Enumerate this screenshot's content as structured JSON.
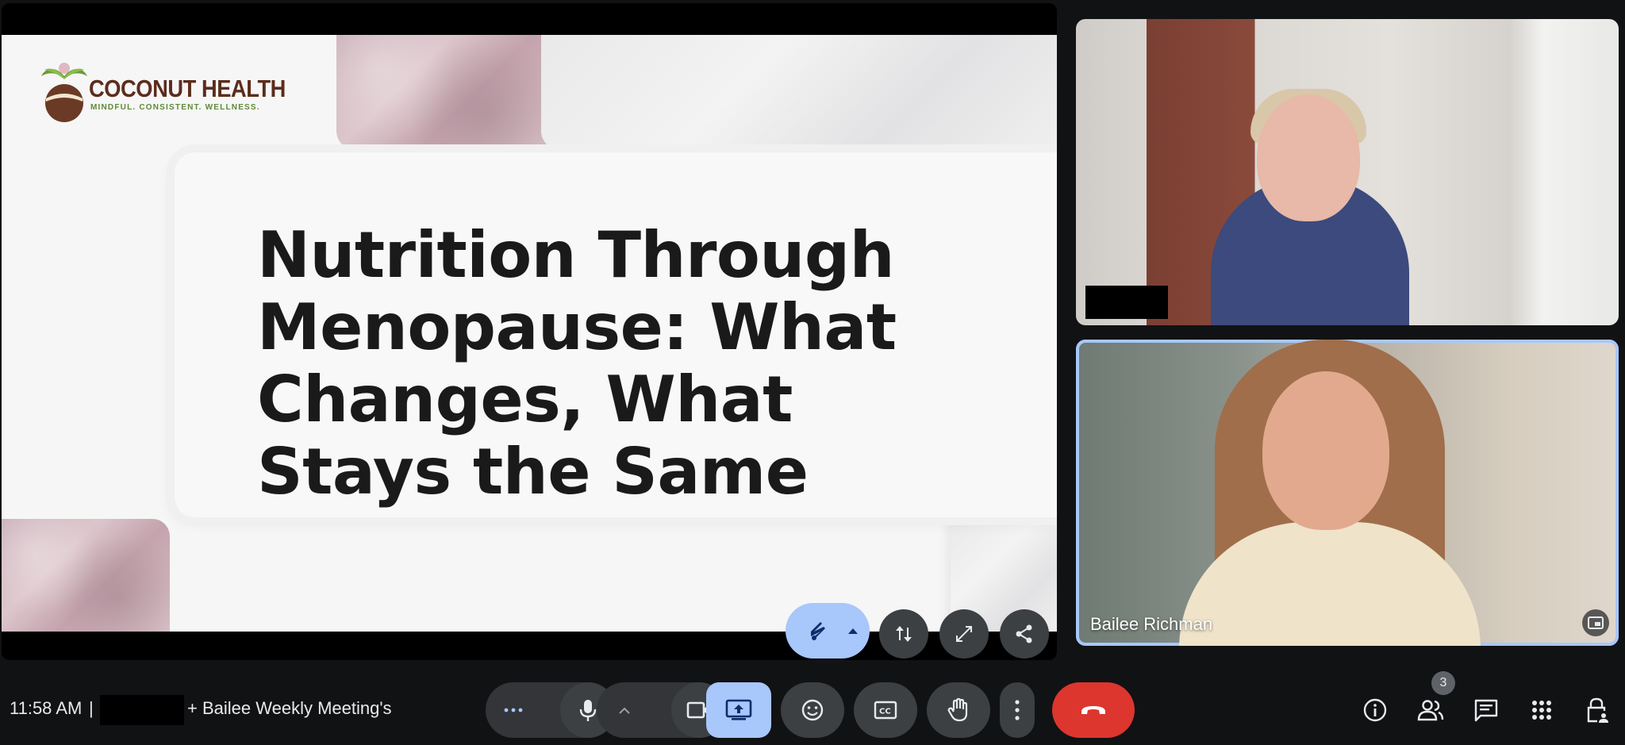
{
  "slide": {
    "logo_name": "COCONUT HEALTH",
    "logo_tagline": "MINDFUL. CONSISTENT. WELLNESS.",
    "title": "Nutrition Through Menopause: What Changes, What Stays the Same"
  },
  "slide_controls": [
    {
      "name": "annotate",
      "icon": "pen-annotate-icon"
    },
    {
      "name": "swap-layout",
      "icon": "swap-vertical-icon"
    },
    {
      "name": "fullscreen",
      "icon": "expand-diagonal-icon"
    },
    {
      "name": "share",
      "icon": "share-icon"
    }
  ],
  "participants": [
    {
      "name": "",
      "redacted": true
    },
    {
      "name": "Bailee Richman",
      "active_speaker": true
    }
  ],
  "bottom_bar": {
    "time": "11:58 AM",
    "separator": "|",
    "meeting_name": "+ Bailee Weekly Meeting's",
    "participant_count": "3"
  },
  "controls": [
    {
      "name": "more-options",
      "icon": "more-horizontal-icon"
    },
    {
      "name": "microphone",
      "icon": "mic-icon"
    },
    {
      "name": "camera-options",
      "icon": "chevron-up-icon"
    },
    {
      "name": "camera",
      "icon": "videocam-icon"
    },
    {
      "name": "present",
      "icon": "present-screen-icon"
    },
    {
      "name": "emoji",
      "icon": "emoji-icon"
    },
    {
      "name": "captions",
      "icon": "closed-captions-icon"
    },
    {
      "name": "raise-hand",
      "icon": "hand-icon"
    },
    {
      "name": "more",
      "icon": "more-vertical-icon"
    },
    {
      "name": "leave-call",
      "icon": "call-end-icon"
    }
  ],
  "right_controls": [
    {
      "name": "meeting-details",
      "icon": "info-icon"
    },
    {
      "name": "people",
      "icon": "people-icon"
    },
    {
      "name": "chat",
      "icon": "chat-icon"
    },
    {
      "name": "activities",
      "icon": "apps-grid-icon"
    },
    {
      "name": "host-controls",
      "icon": "lock-person-icon"
    }
  ],
  "colors": {
    "background": "#111214",
    "control_button": "#3c4043",
    "present_active": "#a8c7fa",
    "end_call": "#dc362e",
    "speaker_border": "#a8c7fa"
  }
}
